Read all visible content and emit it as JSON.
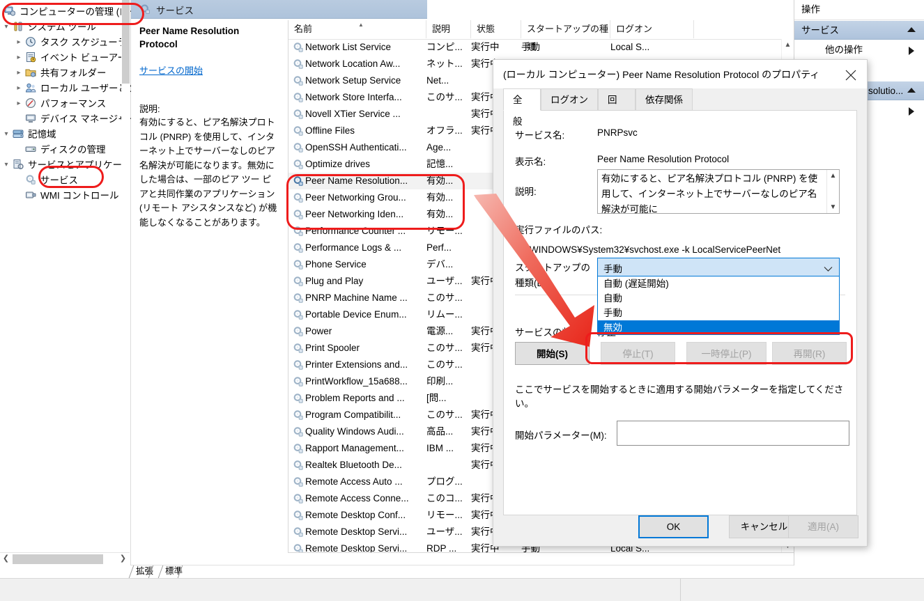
{
  "tree": {
    "root": "コンピューターの管理 (ローカノ",
    "items": [
      {
        "label": "システム ツール",
        "depth": 1,
        "chev": "v",
        "icon": "tools-icon"
      },
      {
        "label": "タスク スケジューラ",
        "depth": 2,
        "chev": ">",
        "icon": "clock-icon"
      },
      {
        "label": "イベント ビューアー",
        "depth": 2,
        "chev": ">",
        "icon": "event-log-icon"
      },
      {
        "label": "共有フォルダー",
        "depth": 2,
        "chev": ">",
        "icon": "shared-folder-icon"
      },
      {
        "label": "ローカル ユーザーとグル",
        "depth": 2,
        "chev": ">",
        "icon": "users-icon"
      },
      {
        "label": "パフォーマンス",
        "depth": 2,
        "chev": ">",
        "icon": "performance-icon"
      },
      {
        "label": "デバイス マネージャー",
        "depth": 2,
        "chev": "",
        "icon": "device-manager-icon"
      },
      {
        "label": "記憶域",
        "depth": 1,
        "chev": "v",
        "icon": "storage-icon"
      },
      {
        "label": "ディスクの管理",
        "depth": 2,
        "chev": "",
        "icon": "disk-icon"
      },
      {
        "label": "サービスとアプリケーション",
        "depth": 1,
        "chev": "v",
        "icon": "services-apps-icon"
      },
      {
        "label": "サービス",
        "depth": 2,
        "chev": "",
        "icon": "service-gear-icon",
        "highlighted": true
      },
      {
        "label": "WMI コントロール",
        "depth": 2,
        "chev": "",
        "icon": "wmi-icon"
      }
    ]
  },
  "middle": {
    "header_title": "サービス",
    "detail": {
      "service_title": "Peer Name Resolution Protocol",
      "start_link": "サービスの開始",
      "description_label": "説明:",
      "description": "有効にすると、ピア名解決プロトコル (PNRP) を使用して、インターネット上でサーバーなしのピア名解決が可能になります。無効にした場合は、一部のピア ツー ピアと共同作業のアプリケーション (リモート アシスタンスなど) が機能しなくなることがあります。"
    },
    "columns": [
      "名前",
      "説明",
      "状態",
      "スタートアップの種類",
      "ログオン"
    ],
    "rows": [
      {
        "name": "Network List Service",
        "desc": "コンピ...",
        "state": "実行中",
        "startup": "手動",
        "logon": "Local S..."
      },
      {
        "name": "Network Location Aw...",
        "desc": "ネット...",
        "state": "実行中",
        "startup": "",
        "logon": ""
      },
      {
        "name": "Network Setup Service",
        "desc": "Net...",
        "state": "",
        "startup": "",
        "logon": ""
      },
      {
        "name": "Network Store Interfa...",
        "desc": "このサ...",
        "state": "実行中",
        "startup": "",
        "logon": ""
      },
      {
        "name": "Novell XTier Service ...",
        "desc": "",
        "state": "実行中",
        "startup": "",
        "logon": ""
      },
      {
        "name": "Offline Files",
        "desc": "オフラ...",
        "state": "実行中",
        "startup": "",
        "logon": ""
      },
      {
        "name": "OpenSSH Authenticati...",
        "desc": "Age...",
        "state": "",
        "startup": "",
        "logon": ""
      },
      {
        "name": "Optimize drives",
        "desc": "記憶...",
        "state": "",
        "startup": "",
        "logon": ""
      },
      {
        "name": "Peer Name Resolution...",
        "desc": "有効...",
        "state": "",
        "startup": "",
        "logon": "",
        "selected": true
      },
      {
        "name": "Peer Networking Grou...",
        "desc": "有効...",
        "state": "",
        "startup": "",
        "logon": ""
      },
      {
        "name": "Peer Networking Iden...",
        "desc": "有効...",
        "state": "",
        "startup": "",
        "logon": ""
      },
      {
        "name": "Performance Counter ...",
        "desc": "リモー...",
        "state": "",
        "startup": "",
        "logon": ""
      },
      {
        "name": "Performance Logs & ...",
        "desc": "Perf...",
        "state": "",
        "startup": "",
        "logon": ""
      },
      {
        "name": "Phone Service",
        "desc": "デバ...",
        "state": "",
        "startup": "",
        "logon": ""
      },
      {
        "name": "Plug and Play",
        "desc": "ユーザ...",
        "state": "実行中",
        "startup": "",
        "logon": ""
      },
      {
        "name": "PNRP Machine Name ...",
        "desc": "このサ...",
        "state": "",
        "startup": "",
        "logon": ""
      },
      {
        "name": "Portable Device Enum...",
        "desc": "リムー...",
        "state": "",
        "startup": "",
        "logon": ""
      },
      {
        "name": "Power",
        "desc": "電源...",
        "state": "実行中",
        "startup": "",
        "logon": ""
      },
      {
        "name": "Print Spooler",
        "desc": "このサ...",
        "state": "実行中",
        "startup": "",
        "logon": ""
      },
      {
        "name": "Printer Extensions and...",
        "desc": "このサ...",
        "state": "",
        "startup": "",
        "logon": ""
      },
      {
        "name": "PrintWorkflow_15a688...",
        "desc": "印刷...",
        "state": "",
        "startup": "",
        "logon": ""
      },
      {
        "name": "Problem Reports and ...",
        "desc": "[問...",
        "state": "",
        "startup": "",
        "logon": ""
      },
      {
        "name": "Program Compatibilit...",
        "desc": "このサ...",
        "state": "実行中",
        "startup": "",
        "logon": ""
      },
      {
        "name": "Quality Windows Audi...",
        "desc": "高品...",
        "state": "実行中",
        "startup": "",
        "logon": ""
      },
      {
        "name": "Rapport Management...",
        "desc": "IBM ...",
        "state": "実行中",
        "startup": "",
        "logon": ""
      },
      {
        "name": "Realtek Bluetooth De...",
        "desc": "",
        "state": "実行中",
        "startup": "",
        "logon": ""
      },
      {
        "name": "Remote Access Auto ...",
        "desc": "プログ...",
        "state": "",
        "startup": "",
        "logon": ""
      },
      {
        "name": "Remote Access Conne...",
        "desc": "このコ...",
        "state": "実行中",
        "startup": "",
        "logon": ""
      },
      {
        "name": "Remote Desktop Conf...",
        "desc": "リモー...",
        "state": "実行中",
        "startup": "",
        "logon": ""
      },
      {
        "name": "Remote Desktop Servi...",
        "desc": "ユーザ...",
        "state": "実行中",
        "startup": "",
        "logon": ""
      },
      {
        "name": "Remote Desktop Servi...",
        "desc": "RDP ...",
        "state": "実行中",
        "startup": "手動",
        "logon": "Local S..."
      }
    ],
    "tabs": [
      "拡張",
      "標準"
    ]
  },
  "actions": {
    "header": "操作",
    "group1": "サービス",
    "group1_item": "他の操作",
    "group2": "solutio...",
    "group2_item": ""
  },
  "dialog": {
    "title": "(ローカル コンピューター) Peer Name Resolution Protocol のプロパティ",
    "close_icon": "close-icon",
    "tabs": [
      "全般",
      "ログオン",
      "回復",
      "依存関係"
    ],
    "active_tab": "全般",
    "service_name_label": "サービス名:",
    "service_name_value": "PNRPsvc",
    "display_name_label": "表示名:",
    "display_name_value": "Peer Name Resolution Protocol",
    "description_label": "説明:",
    "description_value": "有効にすると、ピア名解決プロトコル (PNRP) を使用して、インターネット上でサーバーなしのピア名解決が可能に",
    "exe_path_label": "実行ファイルのパス:",
    "exe_path_value": "C:¥WINDOWS¥System32¥svchost.exe -k LocalServicePeerNet",
    "startup_label_line1": "スタートアップの",
    "startup_label_line2": "種類(E):",
    "startup_selected": "手動",
    "startup_options": [
      "自動 (遅延開始)",
      "自動",
      "手動",
      "無効"
    ],
    "startup_highlighted": "無効",
    "status_label": "サービスの状態:",
    "status_value": "停止",
    "buttons": [
      {
        "label": "開始(S)",
        "disabled": false
      },
      {
        "label": "停止(T)",
        "disabled": true
      },
      {
        "label": "一時停止(P)",
        "disabled": true
      },
      {
        "label": "再開(R)",
        "disabled": true
      }
    ],
    "hint": "ここでサービスを開始するときに適用する開始パラメーターを指定してください。",
    "param_label": "開始パラメーター(M):",
    "param_value": "",
    "footer_buttons": [
      {
        "label": "OK",
        "style": "default"
      },
      {
        "label": "キャンセル",
        "style": "normal"
      },
      {
        "label": "適用(A)",
        "style": "disabled"
      }
    ]
  },
  "colors": {
    "annotation_red": "#ee1c1c",
    "selection_blue": "#0078d7",
    "combo_fill": "#cfe4f7",
    "header_blue": "#aec3db"
  }
}
